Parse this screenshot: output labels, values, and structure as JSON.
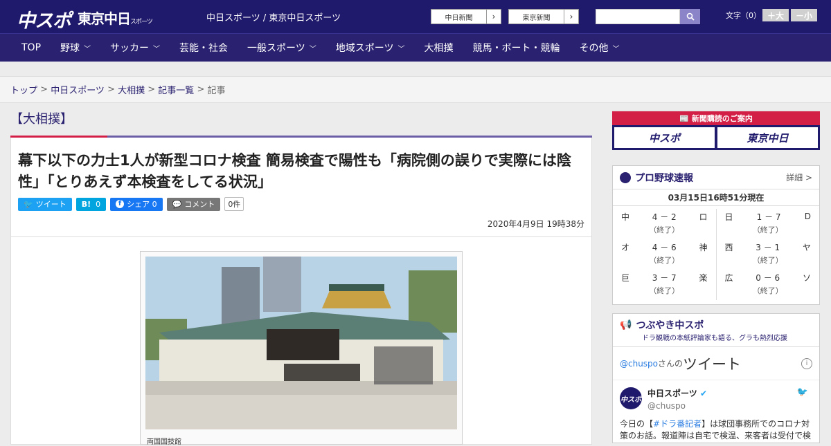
{
  "header": {
    "logo_main": "中スポ",
    "logo_tokyo": "東京中日",
    "logo_tokyo_sub": "スポーツ",
    "site_title": "中日スポーツ / 東京中日スポーツ",
    "paper_buttons": [
      {
        "label": "中日新聞"
      },
      {
        "label": "東京新聞"
      }
    ],
    "font_size_label": "文字（0）",
    "font_plus": "＋大",
    "font_minus": "－小"
  },
  "nav": {
    "items": [
      {
        "label": "TOP",
        "dropdown": false
      },
      {
        "label": "野球",
        "dropdown": true
      },
      {
        "label": "サッカー",
        "dropdown": true
      },
      {
        "label": "芸能・社会",
        "dropdown": false
      },
      {
        "label": "一般スポーツ",
        "dropdown": true
      },
      {
        "label": "地域スポーツ",
        "dropdown": true
      },
      {
        "label": "大相撲",
        "dropdown": false
      },
      {
        "label": "競馬・ボート・競輪",
        "dropdown": false
      },
      {
        "label": "その他",
        "dropdown": true
      }
    ]
  },
  "breadcrumb": [
    "トップ",
    "中日スポーツ",
    "大相撲",
    "記事一覧",
    "記事"
  ],
  "article": {
    "category": "【大相撲】",
    "headline": "幕下以下の力士1人が新型コロナ検査 簡易検査で陽性も「病院側の誤りで実際には陰性」「とりあえず本検査をしてる状況」",
    "share": {
      "twitter": "ツイート",
      "hatena": "B!",
      "hatena_count": "0",
      "facebook": "シェア",
      "facebook_count": "0",
      "comment": "コメント",
      "comment_count": "0件"
    },
    "date": "2020年4月9日 19時38分",
    "photo_caption": "両国国技館"
  },
  "sidebar": {
    "subscribe_title": "新聞購読のご案内",
    "subscribe_buttons": [
      "中スポ",
      "東京中日"
    ],
    "baseball": {
      "title": "プロ野球速報",
      "detail": "詳細 >",
      "as_of": "03月15日16時51分現在",
      "games": [
        {
          "home": "中",
          "score": "4 － 2",
          "away": "ロ",
          "status": "（終了）"
        },
        {
          "home": "日",
          "score": "1 － 7",
          "away": "D",
          "status": "（終了）"
        },
        {
          "home": "オ",
          "score": "4 － 6",
          "away": "神",
          "status": "（終了）"
        },
        {
          "home": "西",
          "score": "3 － 1",
          "away": "ヤ",
          "status": "（終了）"
        },
        {
          "home": "巨",
          "score": "3 － 7",
          "away": "楽",
          "status": "（終了）"
        },
        {
          "home": "広",
          "score": "0 － 6",
          "away": "ソ",
          "status": "（終了）"
        }
      ]
    },
    "tweets": {
      "title": "つぶやき中スポ",
      "subtitle": "ドラ観戦の本紙評論家も語る、グラも熱烈応援",
      "handle": "@chuspo",
      "handle_suffix": "さんの",
      "heading": "ツイート",
      "tweet": {
        "avatar": "中スポ",
        "name": "中日スポーツ",
        "user": "@chuspo",
        "text_before": "今日の【",
        "hashtag": "#ドラ番記者",
        "text_after": "】は球団事務所でのコロナ対策のお話。報道陣は自宅で検温、来客者は受付で検"
      }
    }
  },
  "colors": {
    "brand_navy": "#201a6c",
    "accent_red": "#d31f45",
    "purple": "#6b5da6",
    "twitter": "#1da1f2",
    "facebook": "#1877f2"
  }
}
